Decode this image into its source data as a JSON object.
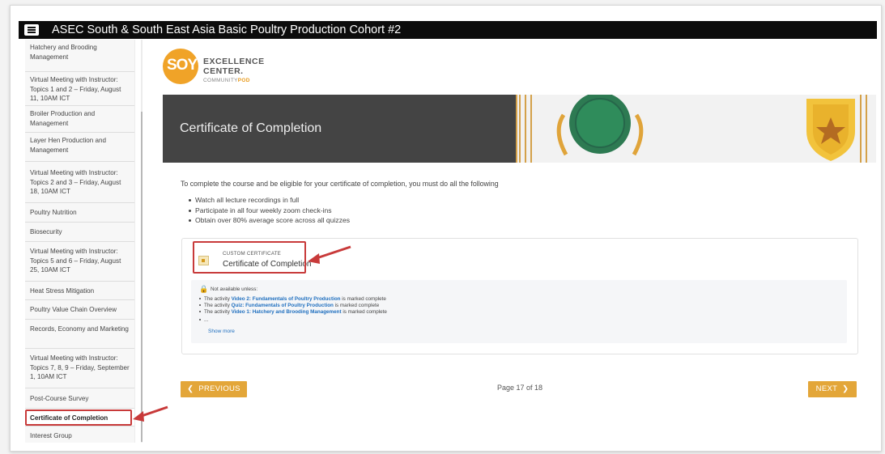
{
  "header": {
    "course_title": "ASEC South & South East Asia Basic Poultry Production Cohort #2"
  },
  "sidebar": {
    "items": [
      "Hatchery and Brooding Management",
      "Virtual Meeting with Instructor: Topics 1 and 2 – Friday, August 11, 10AM ICT",
      "Broiler Production and Management",
      "Layer Hen Production and Management",
      "Virtual Meeting with Instructor: Topics 2 and 3 – Friday, August 18, 10AM ICT",
      "Poultry Nutrition",
      "Biosecurity",
      "Virtual Meeting with Instructor: Topics 5 and 6 – Friday, August 25, 10AM ICT",
      "Heat Stress Mitigation",
      "Poultry Value Chain Overview",
      "Records, Economy and Marketing",
      "Virtual Meeting with Instructor: Topics 7, 8, 9 – Friday, September 1, 10AM ICT",
      "Post-Course Survey",
      "Certificate of Completion",
      "Interest Group"
    ],
    "active_index": 13
  },
  "logo": {
    "soy": "SOY",
    "line1": "EXCELLENCE",
    "line2": "CENTER.",
    "community": "COMMUNITY",
    "pod": "POD"
  },
  "banner": {
    "title": "Certificate of Completion"
  },
  "content": {
    "intro": "To complete the course and be eligible for your certificate of completion, you must do all the following",
    "requirements": [
      "Watch all lecture recordings in full",
      "Participate in all four weekly zoom check-ins",
      "Obtain over 80% average score across all quizzes"
    ]
  },
  "activity": {
    "type": "CUSTOM CERTIFICATE",
    "name": "Certificate of Completion",
    "restriction": {
      "not_available": "Not available unless:",
      "conditions": [
        {
          "prefix": "The activity ",
          "link": "Video 2: Fundamentals of Poultry Production",
          "suffix": " is marked complete"
        },
        {
          "prefix": "The activity ",
          "link": "Quiz: Fundamentals of Poultry Production",
          "suffix": " is marked complete"
        },
        {
          "prefix": "The activity ",
          "link": "Video 1: Hatchery and Brooding Management",
          "suffix": " is marked complete"
        }
      ],
      "ellipsis": "...",
      "show_more": "Show more"
    }
  },
  "nav": {
    "previous": "PREVIOUS",
    "next": "NEXT",
    "page_info": "Page 17 of 18"
  },
  "colors": {
    "accent": "#e3a639",
    "highlight": "#c83a3a",
    "link": "#1f6fbf",
    "banner_dark": "#444444"
  }
}
